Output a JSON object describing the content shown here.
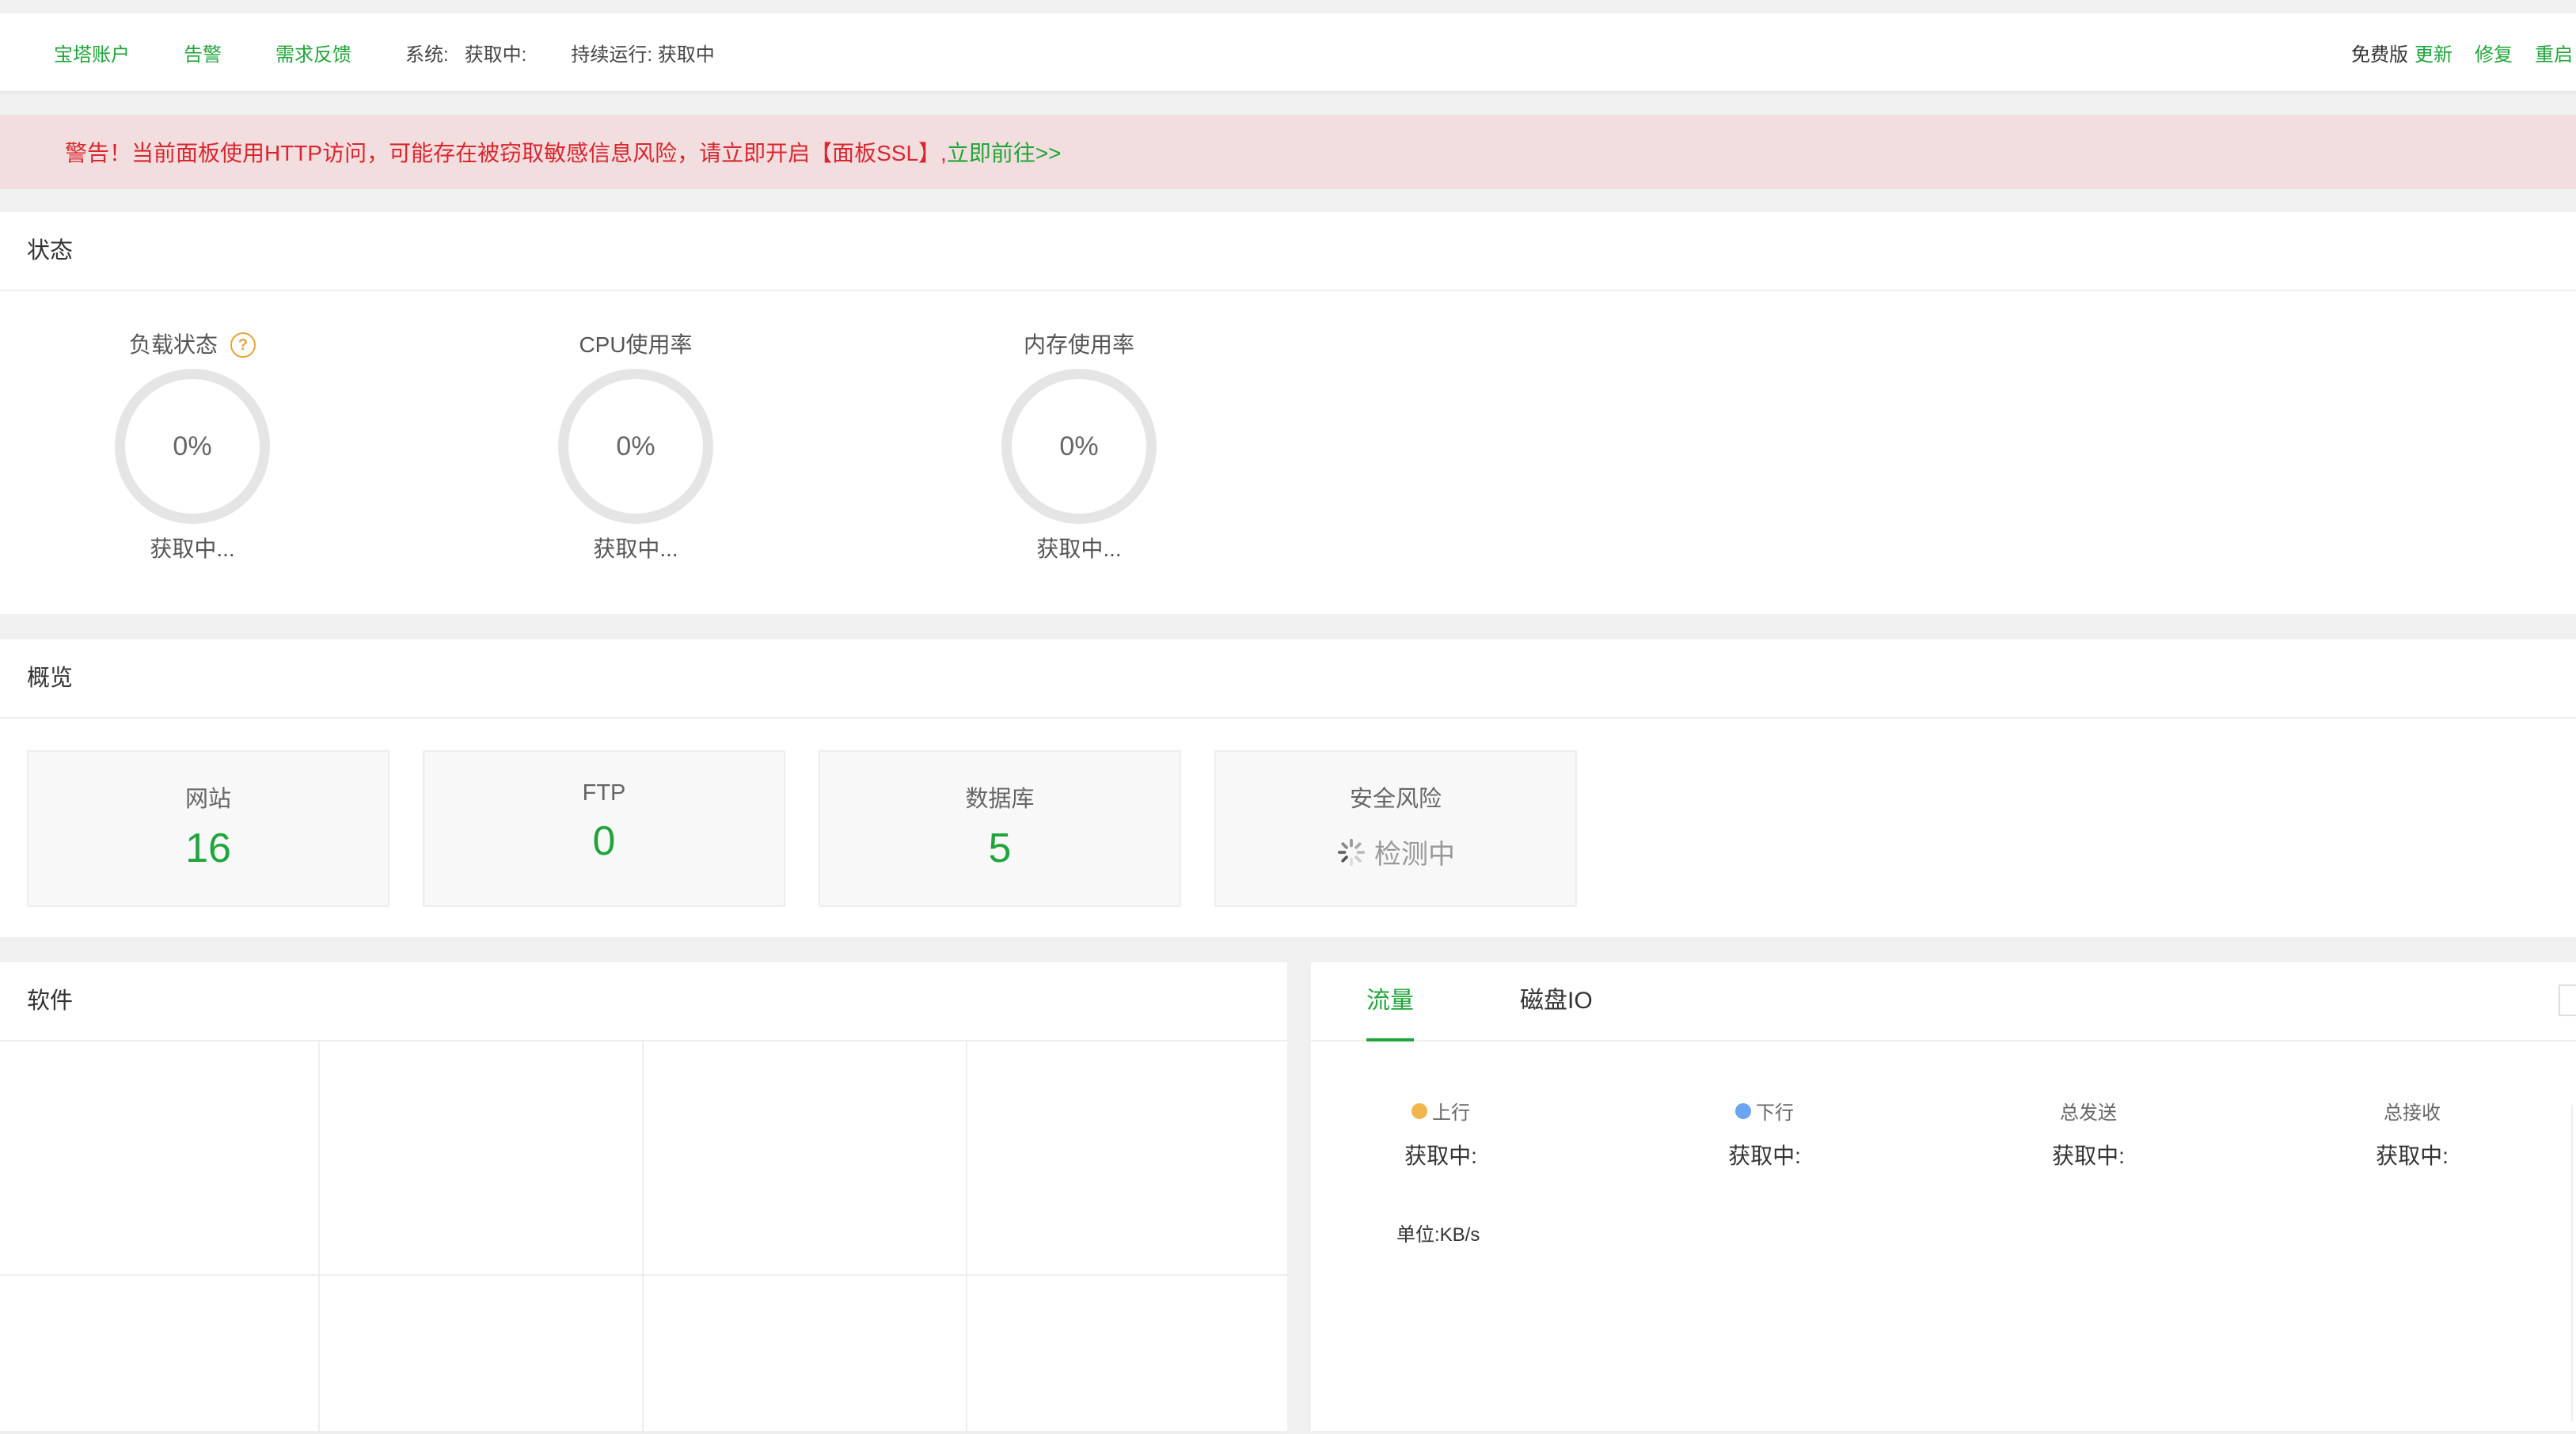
{
  "topbar": {
    "links": [
      "宝塔账户",
      "告警",
      "需求反馈"
    ],
    "system_label": "系统:",
    "system_value": "获取中:",
    "uptime_label": "持续运行:",
    "uptime_value": "获取中",
    "edition": "免费版",
    "actions": [
      "更新",
      "修复",
      "重启"
    ]
  },
  "warning": {
    "text": "警告！当前面板使用HTTP访问，可能存在被窃取敏感信息风险，请立即开启【面板SSL】,",
    "link": "立即前往>>"
  },
  "status": {
    "title": "状态",
    "gauges": [
      {
        "label": "负载状态",
        "value": "0%",
        "sub": "获取中...",
        "help": "?"
      },
      {
        "label": "CPU使用率",
        "value": "0%",
        "sub": "获取中..."
      },
      {
        "label": "内存使用率",
        "value": "0%",
        "sub": "获取中..."
      }
    ]
  },
  "overview": {
    "title": "概览",
    "cards": [
      {
        "label": "网站",
        "value": "16"
      },
      {
        "label": "FTP",
        "value": "0"
      },
      {
        "label": "数据库",
        "value": "5"
      },
      {
        "label": "安全风险",
        "value": "检测中"
      }
    ]
  },
  "software": {
    "title": "软件"
  },
  "traffic": {
    "tabs": [
      "流量",
      "磁盘IO"
    ],
    "active_tab": "流量",
    "stats": [
      {
        "label": "上行",
        "value": "获取中:",
        "dot_color": "#f0b64b"
      },
      {
        "label": "下行",
        "value": "获取中:",
        "dot_color": "#6aa4f2"
      },
      {
        "label": "总发送",
        "value": "获取中:"
      },
      {
        "label": "总接收",
        "value": "获取中:"
      }
    ],
    "unit": "单位:KB/s"
  },
  "colors": {
    "accent": "#20a53a",
    "warning_bg": "#f2dede",
    "warning_text": "#d9262f"
  }
}
